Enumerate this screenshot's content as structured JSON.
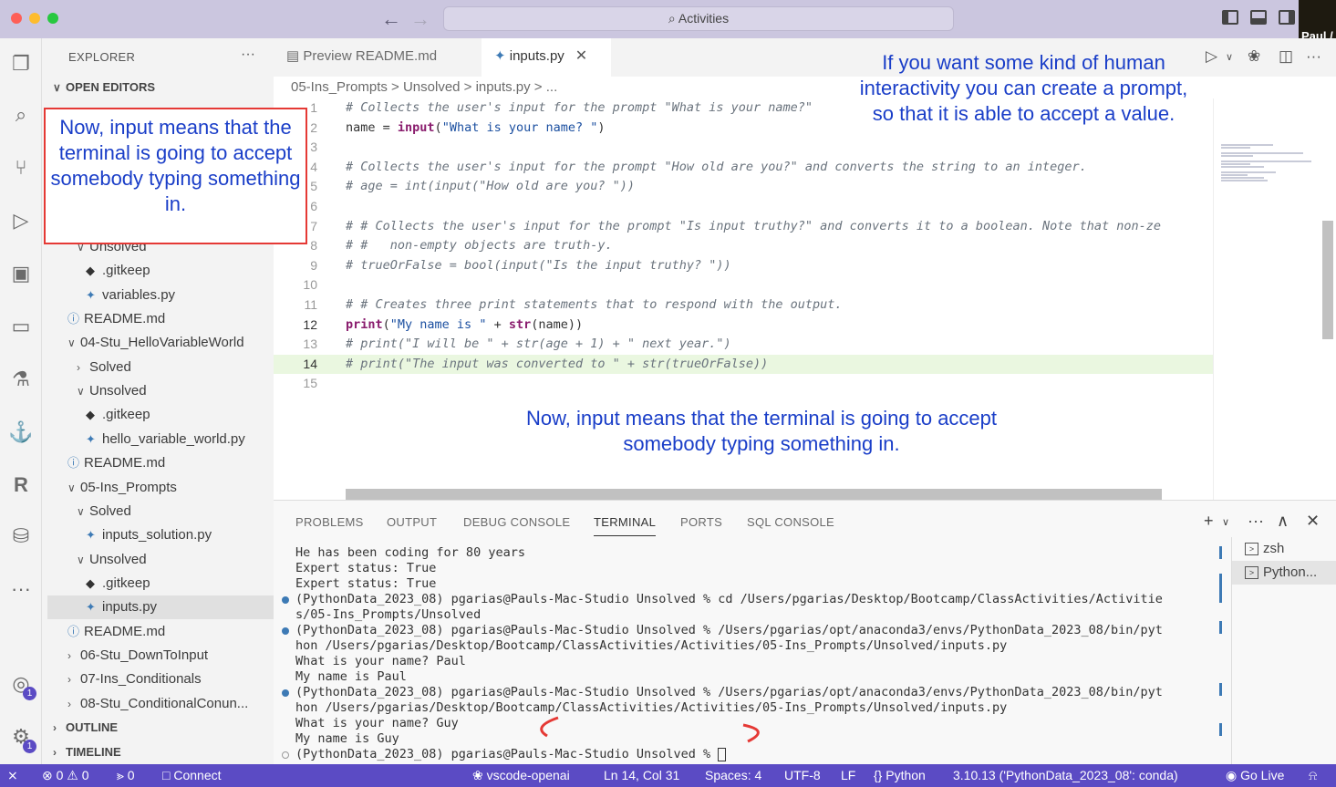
{
  "titlebar": {
    "command_center": "Activities",
    "user_label": "Paul /"
  },
  "sidebar": {
    "title": "EXPLORER",
    "more": "···",
    "open_editors": "OPEN EDITORS",
    "rows": [
      {
        "label": "Unsolved",
        "kind": "folder",
        "open": true
      },
      {
        "label": ".gitkeep",
        "kind": "git"
      },
      {
        "label": "variables.py",
        "kind": "py"
      },
      {
        "label": "README.md",
        "kind": "info"
      },
      {
        "label": "04-Stu_HelloVariableWorld",
        "kind": "folder",
        "open": true
      },
      {
        "label": "Solved",
        "kind": "folder",
        "open": false
      },
      {
        "label": "Unsolved",
        "kind": "folder",
        "open": true
      },
      {
        "label": ".gitkeep",
        "kind": "git"
      },
      {
        "label": "hello_variable_world.py",
        "kind": "py"
      },
      {
        "label": "README.md",
        "kind": "info"
      },
      {
        "label": "05-Ins_Prompts",
        "kind": "folder",
        "open": true
      },
      {
        "label": "Solved",
        "kind": "folder",
        "open": true
      },
      {
        "label": "inputs_solution.py",
        "kind": "py"
      },
      {
        "label": "Unsolved",
        "kind": "folder",
        "open": true
      },
      {
        "label": ".gitkeep",
        "kind": "git"
      },
      {
        "label": "inputs.py",
        "kind": "py",
        "active": true
      },
      {
        "label": "README.md",
        "kind": "info"
      },
      {
        "label": "06-Stu_DownToInput",
        "kind": "folder",
        "open": false
      },
      {
        "label": "07-Ins_Conditionals",
        "kind": "folder",
        "open": false
      },
      {
        "label": "08-Stu_ConditionalConun...",
        "kind": "folder",
        "open": false
      }
    ],
    "outline": "OUTLINE",
    "timeline": "TIMELINE"
  },
  "editor": {
    "tabs": [
      {
        "label": "Preview README.md",
        "active": false
      },
      {
        "label": "inputs.py",
        "active": true
      }
    ],
    "breadcrumb": "05-Ins_Prompts > Unsolved > inputs.py > ...",
    "lines": [
      {
        "n": "1",
        "text": "# Collects the user's input for the prompt \"What is your name?\""
      },
      {
        "n": "2",
        "text": "name = input(\"What is your name? \")"
      },
      {
        "n": "3",
        "text": ""
      },
      {
        "n": "4",
        "text": "# Collects the user's input for the prompt \"How old are you?\" and converts the string to an integer."
      },
      {
        "n": "5",
        "text": "# age = int(input(\"How old are you? \"))"
      },
      {
        "n": "6",
        "text": ""
      },
      {
        "n": "7",
        "text": "# # Collects the user's input for the prompt \"Is input truthy?\" and converts it to a boolean. Note that non-ze"
      },
      {
        "n": "8",
        "text": "# #   non-empty objects are truth-y."
      },
      {
        "n": "9",
        "text": "# trueOrFalse = bool(input(\"Is the input truthy? \"))"
      },
      {
        "n": "10",
        "text": ""
      },
      {
        "n": "11",
        "text": "# # Creates three print statements that to respond with the output."
      },
      {
        "n": "12",
        "text": "print(\"My name is \" + str(name))"
      },
      {
        "n": "13",
        "text": "# print(\"I will be \" + str(age + 1) + \" next year.\")"
      },
      {
        "n": "14",
        "text": "# print(\"The input was converted to \" + str(trueOrFalse))"
      },
      {
        "n": "15",
        "text": ""
      }
    ]
  },
  "annotations": {
    "boxed": "Now, input means that the terminal is going to accept somebody typing something in.",
    "top_right": "If you want some kind of human interactivity you can create a prompt, so that it is able to accept a value.",
    "center": "Now, input means that the terminal is going to accept somebody typing something in."
  },
  "panel": {
    "tabs": [
      "PROBLEMS",
      "OUTPUT",
      "DEBUG CONSOLE",
      "TERMINAL",
      "PORTS",
      "SQL CONSOLE"
    ],
    "active_tab": "TERMINAL",
    "terminal_lines": [
      {
        "text": "He has been coding for 80 years",
        "dot": ""
      },
      {
        "text": "Expert status: True",
        "dot": ""
      },
      {
        "text": "Expert status: True",
        "dot": ""
      },
      {
        "text": "(PythonData_2023_08) pgarias@Pauls-Mac-Studio Unsolved % cd /Users/pgarias/Desktop/Bootcamp/ClassActivities/Activitie",
        "dot": "blue"
      },
      {
        "text": "s/05-Ins_Prompts/Unsolved",
        "dot": ""
      },
      {
        "text": "(PythonData_2023_08) pgarias@Pauls-Mac-Studio Unsolved % /Users/pgarias/opt/anaconda3/envs/PythonData_2023_08/bin/pyt",
        "dot": "blue"
      },
      {
        "text": "hon /Users/pgarias/Desktop/Bootcamp/ClassActivities/Activities/05-Ins_Prompts/Unsolved/inputs.py",
        "dot": ""
      },
      {
        "text": "What is your name? Paul",
        "dot": ""
      },
      {
        "text": "My name is Paul",
        "dot": ""
      },
      {
        "text": "(PythonData_2023_08) pgarias@Pauls-Mac-Studio Unsolved % /Users/pgarias/opt/anaconda3/envs/PythonData_2023_08/bin/pyt",
        "dot": "blue"
      },
      {
        "text": "hon /Users/pgarias/Desktop/Bootcamp/ClassActivities/Activities/05-Ins_Prompts/Unsolved/inputs.py",
        "dot": ""
      },
      {
        "text": "What is your name? Guy",
        "dot": ""
      },
      {
        "text": "My name is Guy",
        "dot": ""
      },
      {
        "text": "(PythonData_2023_08) pgarias@Pauls-Mac-Studio Unsolved % ",
        "dot": "hollow"
      }
    ],
    "terminals": [
      "zsh",
      "Python..."
    ]
  },
  "statusbar": {
    "errors": "0",
    "warnings": "0",
    "ports": "0",
    "connect": "Connect",
    "openai": "vscode-openai",
    "position": "Ln 14, Col 31",
    "spaces": "Spaces: 4",
    "encoding": "UTF-8",
    "eol": "LF",
    "language": "Python",
    "interpreter": "3.10.13 ('PythonData_2023_08': conda)",
    "golive": "Go Live"
  },
  "colors": {
    "accent": "#5b4bc4",
    "annotation_blue": "#1a3ec8",
    "annotation_border": "#e53935"
  }
}
